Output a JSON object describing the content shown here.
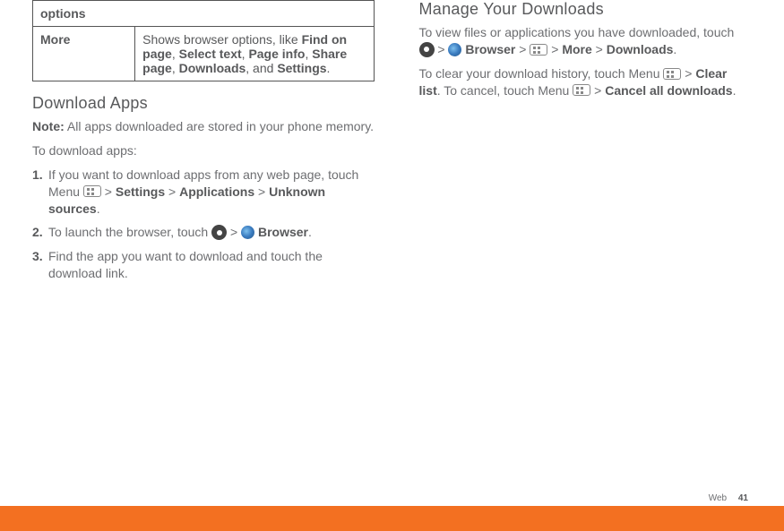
{
  "table": {
    "header": "options",
    "row_label": "More",
    "row_desc_pre": "Shows browser options, like ",
    "opt1": "Find on page",
    "sep1": ", ",
    "opt2": "Select text",
    "sep2": ", ",
    "opt3": "Page info",
    "sep3": ", ",
    "opt4": "Share page",
    "sep4": ", ",
    "opt5": "Downloads",
    "sep5": ", and ",
    "opt6": "Settings",
    "row_desc_post": "."
  },
  "left": {
    "h_download_apps": "Download Apps",
    "note_label": "Note:",
    "note_text": " All apps downloaded are stored in your phone memory.",
    "to_download": "To download apps:",
    "step1_num": "1.",
    "step1_a": "If you want to download apps from any web page, touch Menu ",
    "step1_b": " > ",
    "step1_settings": "Settings",
    "step1_c": " > ",
    "step1_apps": "Applications",
    "step1_d": " > ",
    "step1_unknown": "Unknown sources",
    "step1_e": ".",
    "step2_num": "2.",
    "step2_a": "To launch the browser, touch ",
    "step2_b": " > ",
    "step2_browser": "Browser",
    "step2_c": ".",
    "step3_num": "3.",
    "step3_a": "Find the app you want to download and touch the download link."
  },
  "right": {
    "h_manage": "Manage Your Downloads",
    "p1_a": "To view files or applications you have downloaded, touch ",
    "p1_b": " > ",
    "p1_browser": "Browser",
    "p1_c": " > ",
    "p1_d": " > ",
    "p1_more": "More",
    "p1_e": " > ",
    "p1_downloads": "Downloads",
    "p1_f": ".",
    "p2_a": "To clear your download history, touch Menu ",
    "p2_b": " > ",
    "p2_clear": "Clear list",
    "p2_c": ". To cancel, touch Menu ",
    "p2_d": " > ",
    "p2_cancel": "Cancel all downloads",
    "p2_e": "."
  },
  "footer": {
    "section": "Web",
    "page": "41"
  }
}
